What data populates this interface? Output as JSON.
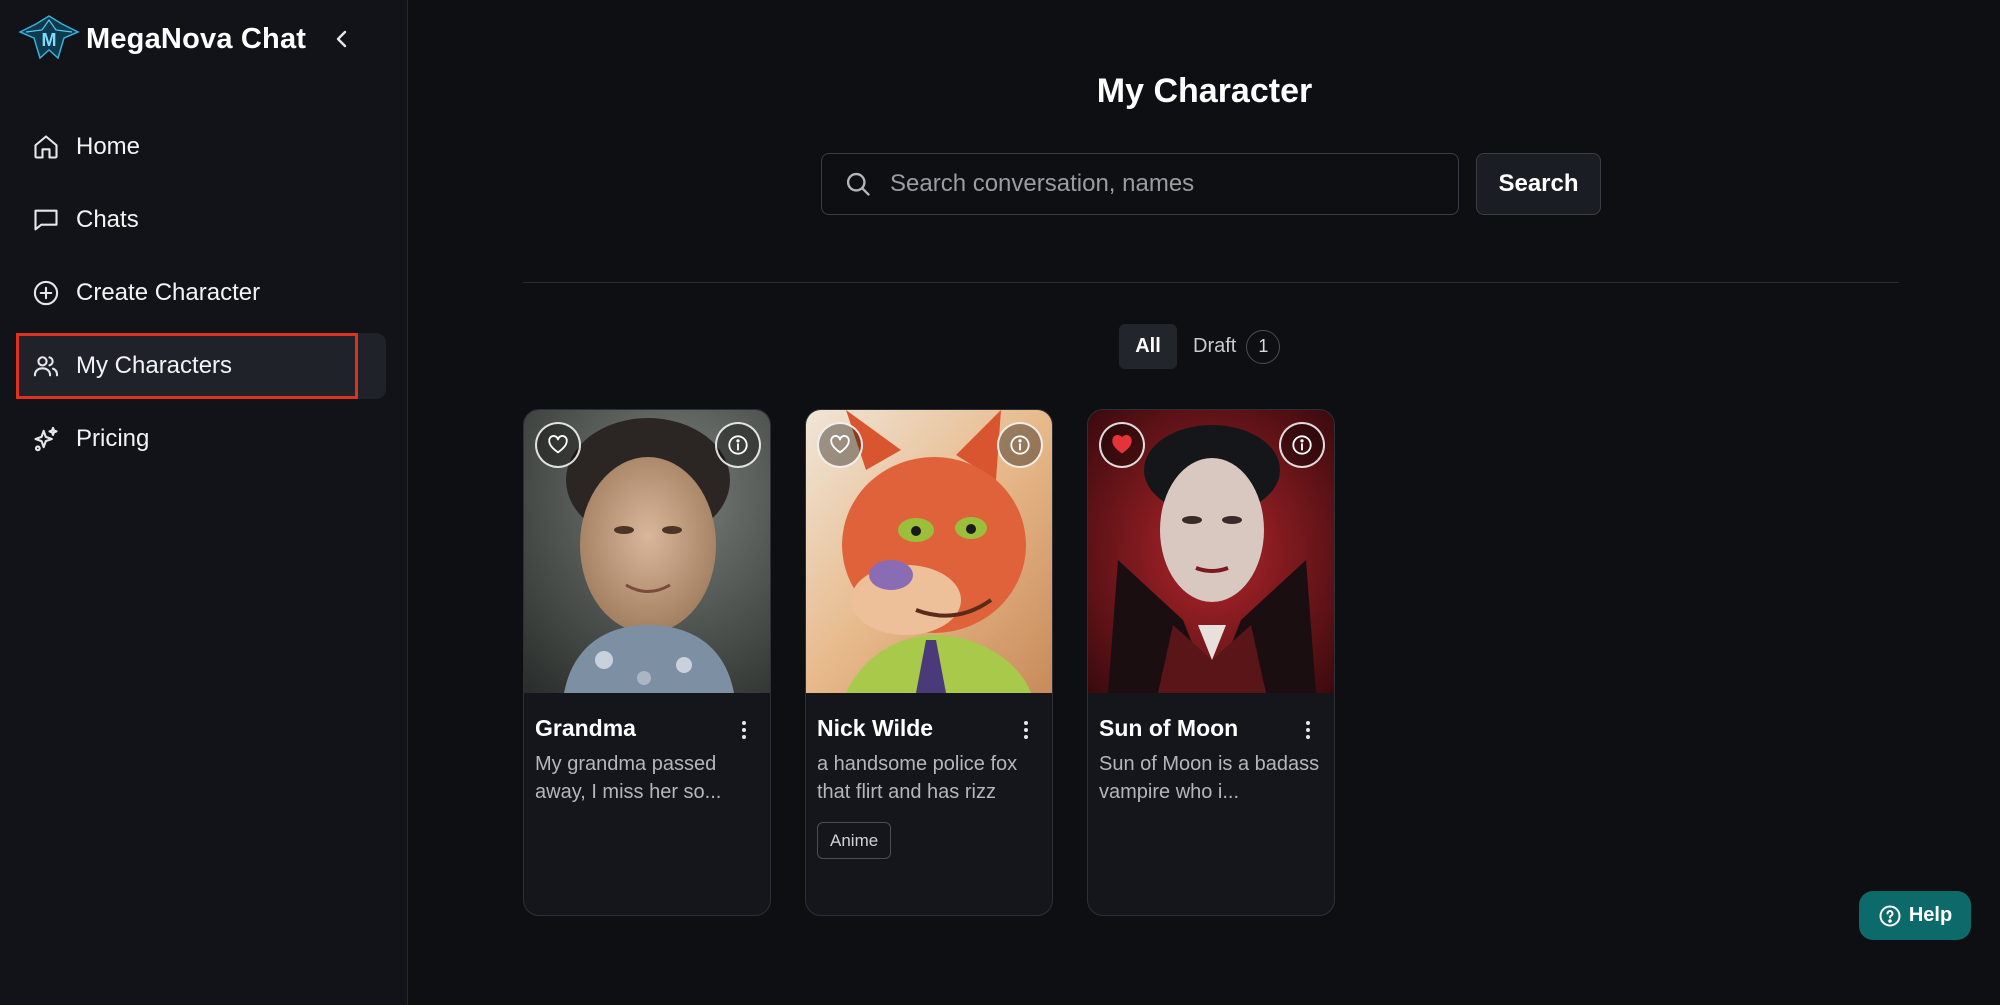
{
  "app": {
    "name": "MegaNova Chat"
  },
  "sidebar": {
    "items": [
      {
        "label": "Home",
        "icon": "home-icon"
      },
      {
        "label": "Chats",
        "icon": "chat-bubble-icon"
      },
      {
        "label": "Create Character",
        "icon": "plus-circle-icon"
      },
      {
        "label": "My Characters",
        "icon": "users-icon",
        "active": true
      },
      {
        "label": "Pricing",
        "icon": "sparkles-icon"
      }
    ]
  },
  "main": {
    "title": "My Character",
    "search": {
      "placeholder": "Search conversation, names",
      "value": "",
      "button_label": "Search"
    },
    "tabs": {
      "all_label": "All",
      "draft_label": "Draft",
      "draft_count": "1"
    },
    "cards": [
      {
        "name": "Grandma",
        "description": "My grandma passed away, I miss her so...",
        "favorited": false,
        "tag": ""
      },
      {
        "name": "Nick Wilde",
        "description": "a handsome police fox that flirt and has rizz",
        "favorited": false,
        "tag": "Anime"
      },
      {
        "name": "Sun of Moon",
        "description": "Sun of Moon is a badass vampire who i...",
        "favorited": true,
        "tag": ""
      }
    ]
  },
  "help": {
    "label": "Help"
  },
  "colors": {
    "accent_teal": "#0d6a6a",
    "highlight_red": "#e0311f",
    "heart_red": "#e5333a",
    "background": "#0d0f13"
  }
}
